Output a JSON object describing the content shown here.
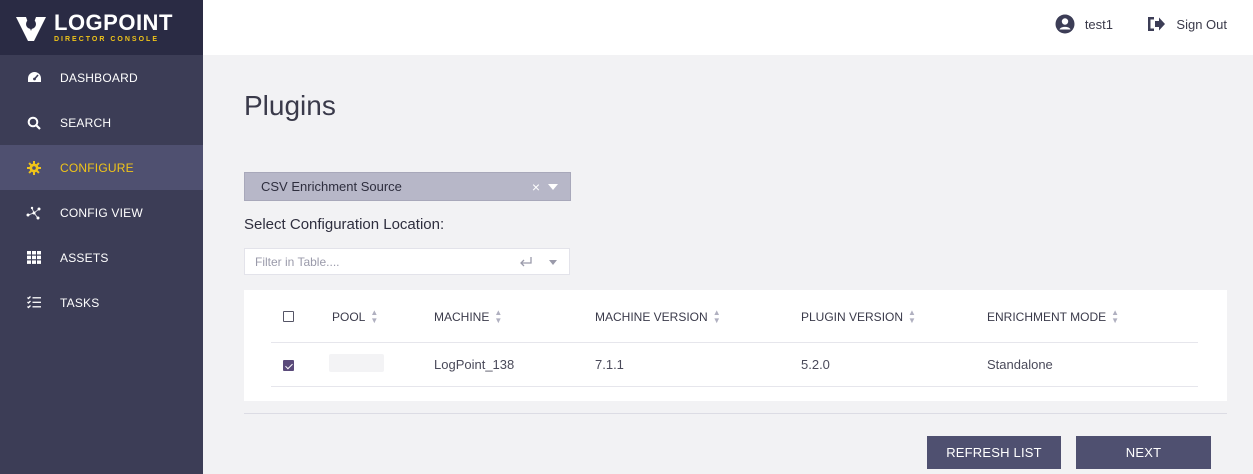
{
  "brand": {
    "name": "LOGPOINT",
    "subtitle": "DIRECTOR CONSOLE"
  },
  "sidebar": {
    "items": [
      {
        "label": "DASHBOARD",
        "icon": "dashboard-gauge-icon",
        "active": false
      },
      {
        "label": "SEARCH",
        "icon": "search-icon",
        "active": false
      },
      {
        "label": "CONFIGURE",
        "icon": "gear-icon",
        "active": true
      },
      {
        "label": "CONFIG VIEW",
        "icon": "network-nodes-icon",
        "active": false
      },
      {
        "label": "ASSETS",
        "icon": "grid-icon",
        "active": false
      },
      {
        "label": "TASKS",
        "icon": "checklist-icon",
        "active": false
      }
    ]
  },
  "header": {
    "username": "test1",
    "signout_label": "Sign Out"
  },
  "main": {
    "title": "Plugins",
    "plugin_select": {
      "value": "CSV Enrichment Source"
    },
    "section_label": "Select Configuration Location:",
    "filter": {
      "placeholder": "Filter in Table...."
    },
    "table": {
      "columns": [
        "POOL",
        "MACHINE",
        "MACHINE VERSION",
        "PLUGIN VERSION",
        "ENRICHMENT MODE"
      ],
      "rows": [
        {
          "checked": true,
          "pool": "",
          "machine": "LogPoint_138",
          "machine_version": "7.1.1",
          "plugin_version": "5.2.0",
          "enrichment_mode": "Standalone"
        }
      ]
    },
    "buttons": {
      "refresh": "REFRESH LIST",
      "next": "NEXT"
    }
  },
  "colors": {
    "sidebar": "#3c3d56",
    "accent": "#f0c419",
    "button": "#4f5070"
  }
}
